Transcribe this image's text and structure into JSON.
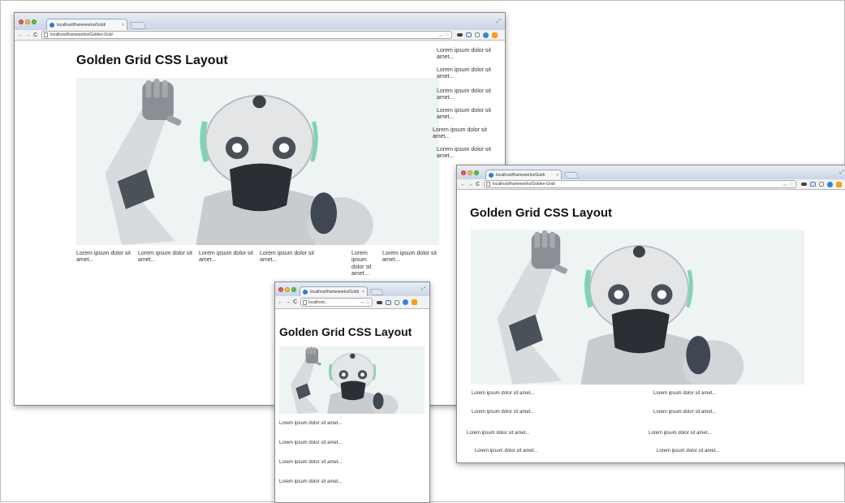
{
  "page": {
    "title": "Golden Grid CSS Layout",
    "lorem": "Lorem ipsum dolor sit amet..."
  },
  "browser": {
    "tab_title_large": "localhost/frameworks/Goldi",
    "tab_title_medium": "localhost/frameworks/Goldi",
    "tab_title_small": "localhost/frameworks/Goldi",
    "tab_close": "×",
    "url_large": "localhost/frameworks/Golden-Grid/",
    "url_medium": "localhost/frameworks/Golden-Grid/",
    "url_small": "localhost...",
    "rss_label": "rss",
    "back": "←",
    "forward": "→",
    "reload": "C",
    "star": "☆",
    "resize_icon": "⤢"
  },
  "colors": {
    "tab_gradient_top": "#e9eef6",
    "tab_gradient_bottom": "#c9d4e5",
    "hero_background": "#eef3f4",
    "robot_accent": "#7fd3b4"
  }
}
